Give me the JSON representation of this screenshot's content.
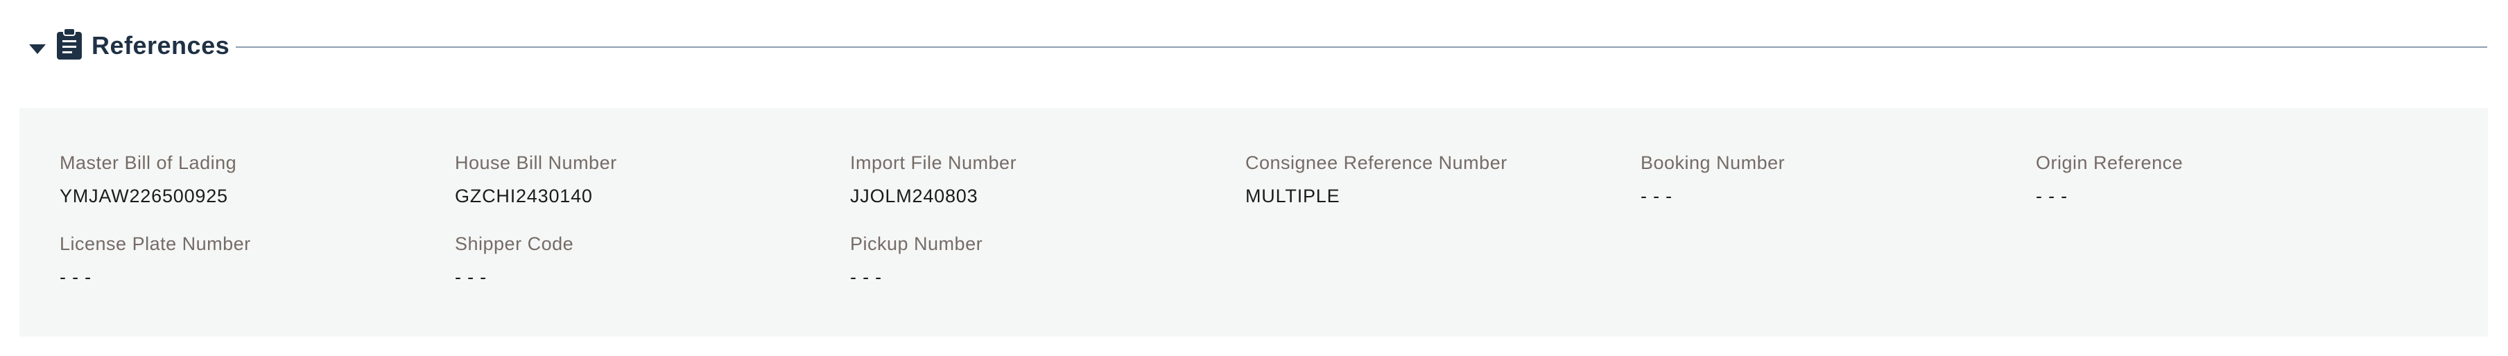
{
  "section": {
    "title": "References",
    "icon": "clipboard-icon",
    "expanded": true
  },
  "colors": {
    "title": "#1f3145",
    "label": "#756b66",
    "value": "#1b1b1b",
    "panel_bg": "#f5f7f6",
    "rule": "#8e9fae"
  },
  "fields": [
    {
      "label": "Master Bill of Lading",
      "value": "YMJAW226500925"
    },
    {
      "label": "House Bill Number",
      "value": "GZCHI2430140"
    },
    {
      "label": "Import File Number",
      "value": "JJOLM240803"
    },
    {
      "label": "Consignee Reference Number",
      "value": "MULTIPLE"
    },
    {
      "label": "Booking Number",
      "value": "- - -"
    },
    {
      "label": "Origin Reference",
      "value": "- - -"
    },
    {
      "label": "License Plate Number",
      "value": "- - -"
    },
    {
      "label": "Shipper Code",
      "value": "- - -"
    },
    {
      "label": "Pickup Number",
      "value": "- - -"
    }
  ]
}
